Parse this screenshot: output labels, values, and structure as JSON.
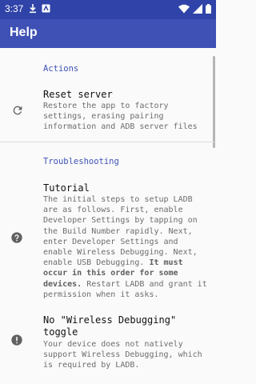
{
  "status_bar": {
    "time": "3:37"
  },
  "app_bar": {
    "title": "Help"
  },
  "sections": {
    "actions": {
      "title": "Actions",
      "reset_server": {
        "title": "Reset server",
        "body": "Restore the app to factory settings, erasing pairing information and ADB server files",
        "icon": "refresh-icon"
      }
    },
    "troubleshooting": {
      "title": "Troubleshooting",
      "tutorial": {
        "title": "Tutorial",
        "body_part1": "The initial steps to setup LADB are as follows. First, enable Developer Settings by tapping on the Build Number rapidly. Next, enter Developer Settings and enable Wireless Debugging. Next, enable USB Debugging.",
        "body_bold": "It must occur in this order for some devices.",
        "body_part2": "Restart LADB and grant it permission when it asks.",
        "icon": "help-circle-icon"
      },
      "no_wireless": {
        "title_line1": "No \"Wireless Debugging\"",
        "title_line2": "toggle",
        "body": "Your device does not natively support Wireless Debugging, which is required by LADB.",
        "icon": "alert-circle-icon"
      }
    }
  },
  "colors": {
    "status_bar": "#2f43a8",
    "app_bar": "#3f51b5",
    "accent": "#3f51b5",
    "background": "#fafafa"
  }
}
